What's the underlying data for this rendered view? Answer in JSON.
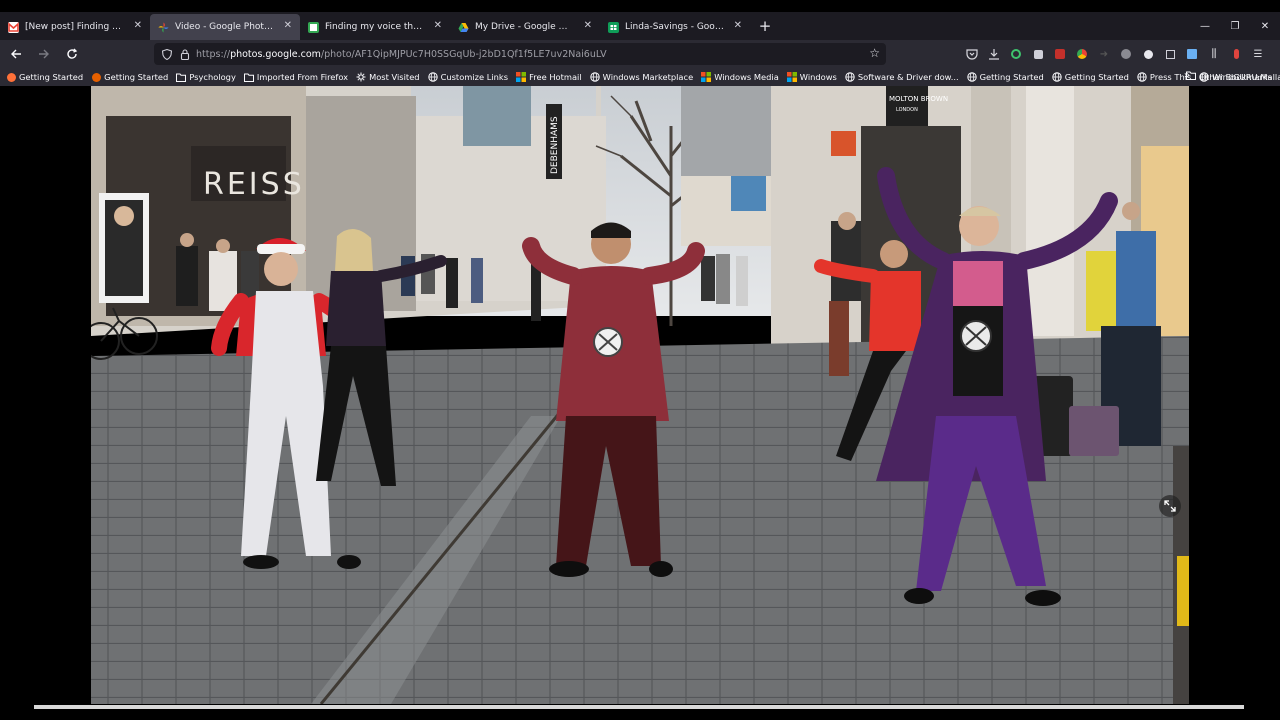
{
  "tabs": [
    {
      "title": "[New post] Finding my voice th",
      "favicon_color": "#ea4335",
      "favicon": "gmail-icon",
      "active": false
    },
    {
      "title": "Video - Google Photos",
      "favicon_color": "#fbbc04",
      "favicon": "google-photos-icon",
      "active": true
    },
    {
      "title": "Finding my voice through a fe",
      "favicon_color": "#34a853",
      "favicon": "page-icon",
      "active": false
    },
    {
      "title": "My Drive - Google Drive",
      "favicon_color": "#4285f4",
      "favicon": "google-drive-icon",
      "active": false
    },
    {
      "title": "Linda-Savings - Google Sheets",
      "favicon_color": "#0f9d58",
      "favicon": "google-sheets-icon",
      "active": false
    }
  ],
  "url": {
    "prefix": "https://",
    "host": "photos.google.com",
    "path": "/photo/AF1QipMJPUc7H0SSGqUb-j2bD1Qf1f5LE7uv2Nai6uLV"
  },
  "bookmarks": [
    {
      "label": "Getting Started",
      "icon": "firefox-icon",
      "color": "#ff7139"
    },
    {
      "label": "Getting Started",
      "icon": "firefox-icon",
      "color": "#e66000"
    },
    {
      "label": "Psychology",
      "icon": "folder-icon",
      "color": "#fbfbfe"
    },
    {
      "label": "Imported From Firefox",
      "icon": "folder-icon",
      "color": "#fbfbfe"
    },
    {
      "label": "Most Visited",
      "icon": "gear-icon",
      "color": "#fbfbfe"
    },
    {
      "label": "Customize Links",
      "icon": "globe-icon",
      "color": "#fbfbfe"
    },
    {
      "label": "Free Hotmail",
      "icon": "windows-icon",
      "color": "#f25022"
    },
    {
      "label": "Windows Marketplace",
      "icon": "globe-icon",
      "color": "#fbfbfe"
    },
    {
      "label": "Windows Media",
      "icon": "windows-icon",
      "color": "#f25022"
    },
    {
      "label": "Windows",
      "icon": "windows-icon",
      "color": "#f25022"
    },
    {
      "label": "Software & Driver dow...",
      "icon": "globe-icon",
      "color": "#fbfbfe"
    },
    {
      "label": "Getting Started",
      "icon": "globe-icon",
      "color": "#fbfbfe"
    },
    {
      "label": "Getting Started",
      "icon": "globe-icon",
      "color": "#fbfbfe"
    },
    {
      "label": "Press This",
      "icon": "globe-icon",
      "color": "#fbfbfe"
    },
    {
      "label": "WindGURU:Mallaig",
      "icon": "globe-icon",
      "color": "#fbfbfe"
    }
  ],
  "bookmarks_overflow": "»",
  "other_bookmarks": "Other Bookmarks",
  "photo": {
    "store_sign": "REISS",
    "store_sign_2": "DEBENHAMS",
    "store_sign_3": "MOLTON BROWN",
    "store_sign_3b": "LONDON"
  }
}
